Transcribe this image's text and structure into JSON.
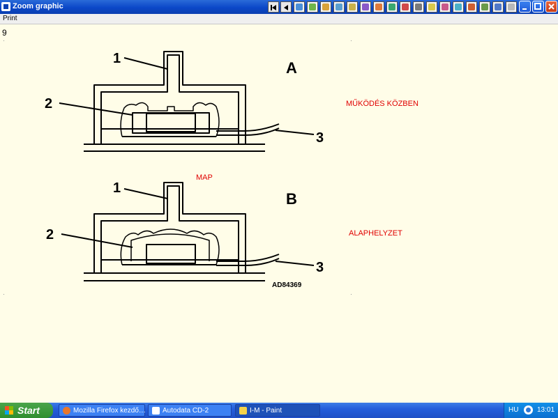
{
  "window": {
    "title": "Zoom graphic",
    "menu": {
      "print_label": "Print"
    },
    "page_number": "9",
    "toolbar_icons": [
      "first-page-icon",
      "previous-page-icon",
      "tool-icon-1",
      "tool-icon-2",
      "tool-icon-3",
      "tool-icon-4",
      "tool-icon-5",
      "tool-icon-6",
      "tool-icon-7",
      "tool-icon-8",
      "tool-icon-9",
      "tool-icon-10",
      "tool-icon-11",
      "tool-icon-12",
      "tool-icon-13",
      "tool-icon-14",
      "tool-icon-15",
      "tool-icon-16",
      "tool-icon-17",
      "tool-icon-18"
    ],
    "controls": {
      "minimize": "minimize-icon",
      "maximize": "maximize-icon",
      "close": "close-icon"
    }
  },
  "diagram": {
    "section_a": {
      "letter": "A",
      "caption": "MŰKÖDÉS KÖZBEN",
      "callouts": [
        "1",
        "2",
        "3"
      ]
    },
    "section_b": {
      "letter": "B",
      "caption": "ALAPHELYZET",
      "callouts": [
        "1",
        "2",
        "3"
      ]
    },
    "center_label": "MAP",
    "reference_code": "AD84369",
    "caption_color": "#e00000"
  },
  "taskbar": {
    "start_label": "Start",
    "tasks": [
      {
        "label": "Mozilla Firefox kezdő…",
        "icon": "firefox-icon"
      },
      {
        "label": "Autodata CD-2",
        "icon": "autodata-icon"
      },
      {
        "label": "I-M - Paint",
        "icon": "paint-icon"
      }
    ],
    "tray": {
      "language": "HU",
      "clock": "13:01"
    }
  }
}
